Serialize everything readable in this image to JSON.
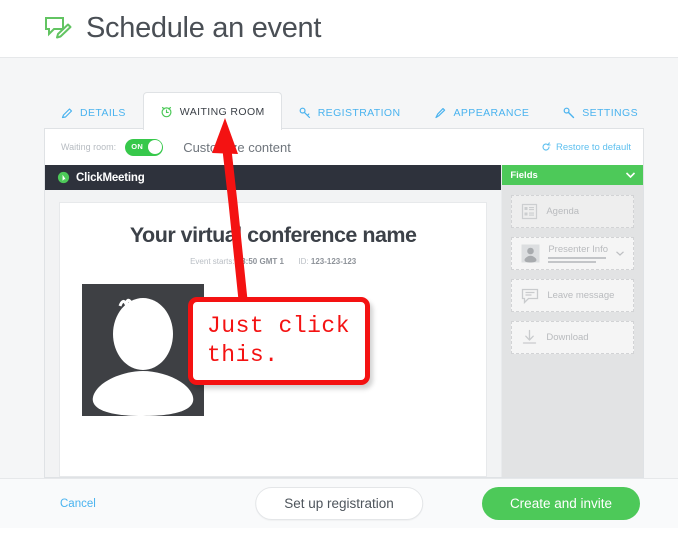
{
  "header": {
    "title": "Schedule an event",
    "icon": "chat-pencil-icon"
  },
  "tabs": [
    {
      "label": "DETAILS",
      "icon": "pencil-icon",
      "active": false
    },
    {
      "label": "WAITING ROOM",
      "icon": "alarm-clock-icon",
      "active": true
    },
    {
      "label": "REGISTRATION",
      "icon": "key-icon",
      "active": false
    },
    {
      "label": "APPEARANCE",
      "icon": "paintbrush-icon",
      "active": false
    },
    {
      "label": "SETTINGS",
      "icon": "wrench-icon",
      "active": false
    }
  ],
  "toolbar": {
    "waiting_room_label": "Waiting room:",
    "toggle_state": "ON",
    "customize_label": "Customize content",
    "restore_label": "Restore to default",
    "restore_icon": "refresh-icon"
  },
  "preview": {
    "brand": "ClickMeeting",
    "brand_icon": "clickmeeting-logo-icon",
    "event_title": "Your virtual conference name",
    "event_meta_prefix": "Event starts:",
    "event_time": "13:50",
    "event_timezone": "GMT 1",
    "event_id_label": "ID:",
    "event_id": "123-123-123",
    "avatar_icon": "person-silhouette-icon"
  },
  "fields_panel": {
    "title": "Fields",
    "chevron_icon": "chevron-down-icon",
    "items": [
      {
        "label": "Agenda",
        "icon": "agenda-list-icon"
      },
      {
        "label": "Presenter Info",
        "icon": "presenter-avatar-icon"
      },
      {
        "label": "Leave message",
        "icon": "message-icon"
      },
      {
        "label": "Download",
        "icon": "download-icon"
      }
    ]
  },
  "footer": {
    "cancel_label": "Cancel",
    "registration_label": "Set up registration",
    "create_label": "Create and invite"
  },
  "annotation": {
    "line1": "Just click",
    "line2": "this.",
    "color": "#f41212",
    "arrow_icon": "red-arrow-icon"
  },
  "colors": {
    "green": "#4dc959",
    "blue": "#4ab3ef",
    "dark": "#2e323c",
    "annotation_red": "#f41212"
  }
}
